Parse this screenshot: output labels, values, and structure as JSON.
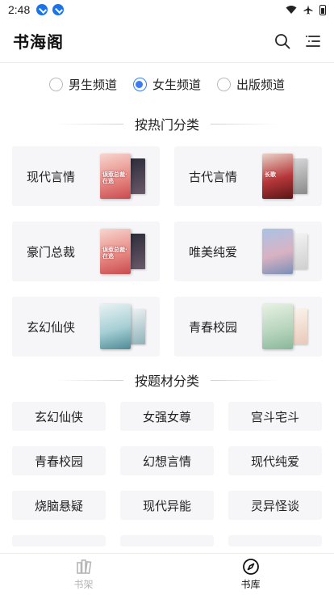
{
  "status_bar": {
    "time": "2:48"
  },
  "header": {
    "title": "书海阁",
    "search_icon": "search-icon",
    "menu_icon": "menu-icon"
  },
  "gender_tabs": [
    {
      "label": "男生频道",
      "selected": false
    },
    {
      "label": "女生频道",
      "selected": true
    },
    {
      "label": "出版频道",
      "selected": false
    }
  ],
  "hot_section": {
    "title": "按热门分类",
    "categories": [
      {
        "label": "现代言情",
        "cover_text": "误惹总裁·在逃"
      },
      {
        "label": "古代言情",
        "cover_text": "长歌"
      },
      {
        "label": "豪门总裁",
        "cover_text": "误惹总裁·在逃"
      },
      {
        "label": "唯美纯爱",
        "cover_text": ""
      },
      {
        "label": "玄幻仙侠",
        "cover_text": ""
      },
      {
        "label": "青春校园",
        "cover_text": ""
      }
    ]
  },
  "theme_section": {
    "title": "按题材分类",
    "tags": [
      "玄幻仙侠",
      "女强女尊",
      "宫斗宅斗",
      "青春校园",
      "幻想言情",
      "现代纯爱",
      "烧脑悬疑",
      "现代异能",
      "灵异怪谈"
    ]
  },
  "bottom_nav": [
    {
      "label": "书架",
      "active": false,
      "icon": "bookshelf-icon"
    },
    {
      "label": "书库",
      "active": true,
      "icon": "compass-icon"
    }
  ],
  "colors": {
    "accent": "#3d7bf5",
    "card_bg": "#f6f6f8",
    "inactive": "#b5b5b5"
  }
}
